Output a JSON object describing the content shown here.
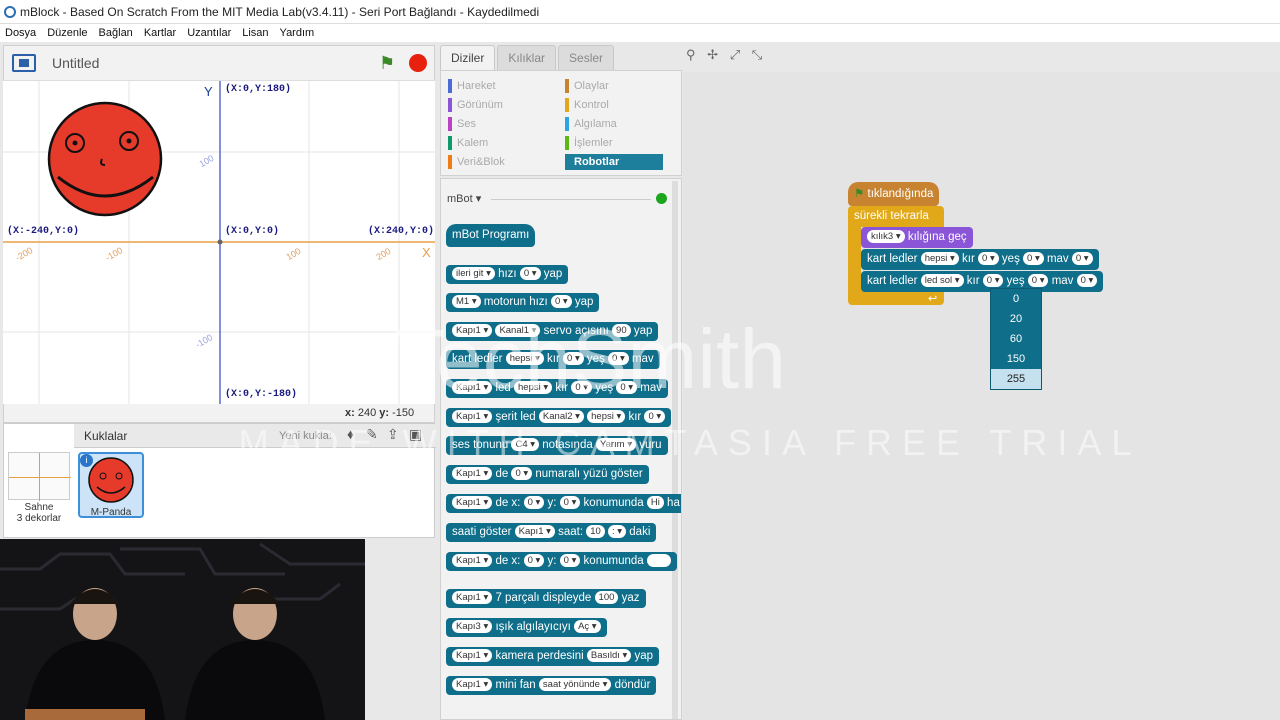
{
  "window": {
    "title": "mBlock - Based On Scratch From the MIT Media Lab(v3.4.11) - Seri Port Bağlandı - Kaydedilmedi"
  },
  "menu": [
    "Dosya",
    "Düzenle",
    "Bağlan",
    "Kartlar",
    "Uzantılar",
    "Lisan",
    "Yardım"
  ],
  "stage": {
    "title": "Untitled",
    "coords": {
      "top": "(X:0,Y:180)",
      "left": "(X:-240,Y:0)",
      "center": "(X:0,Y:0)",
      "right": "(X:240,Y:0)",
      "bottom": "(X:0,Y:-180)"
    },
    "x_axis_label": "X",
    "y_axis_label": "Y",
    "ticks": {
      "x_neg200": "-200",
      "x_neg100": "-100",
      "x_100": "100",
      "x_200": "200",
      "y_100": "100",
      "y_neg100": "-100"
    },
    "mouse_x_label": "x:",
    "mouse_x": "240",
    "mouse_y_label": "y:",
    "mouse_y": "-150"
  },
  "sprites": {
    "header": "Kuklalar",
    "new_sprite": "Yeni kukla:",
    "backdrop_label": "Sahne",
    "backdrop_count": "3 dekorlar",
    "sprite_name": "M-Panda"
  },
  "palette_tabs": [
    "Diziler",
    "Kılıklar",
    "Sesler"
  ],
  "categories": [
    {
      "label": "Hareket",
      "color": "#4a6cd4"
    },
    {
      "label": "Olaylar",
      "color": "#c88330"
    },
    {
      "label": "Görünüm",
      "color": "#8a55d7"
    },
    {
      "label": "Kontrol",
      "color": "#e1a91a"
    },
    {
      "label": "Ses",
      "color": "#bb42c3"
    },
    {
      "label": "Algılama",
      "color": "#2ca5e2"
    },
    {
      "label": "Kalem",
      "color": "#0e9a6c"
    },
    {
      "label": "İşlemler",
      "color": "#5cb712"
    },
    {
      "label": "Veri&Blok",
      "color": "#ee7d16"
    },
    {
      "label": "Robotlar",
      "color": "#1e7f9c"
    }
  ],
  "palette": {
    "group": "mBot",
    "program_block": "mBot Programı",
    "blocks": [
      [
        "ileri git",
        "hızı",
        "0",
        "yap"
      ],
      [
        "M1",
        "motorun hızı",
        "0",
        "yap"
      ],
      [
        "Kapı1",
        "Kanal1",
        "servo açısını",
        "90",
        "yap"
      ],
      [
        "kart ledler",
        "hepsi",
        "kır",
        "0",
        "yeş",
        "0",
        "mav"
      ],
      [
        "Kapı1",
        "led",
        "hepsi",
        "kır",
        "0",
        "yeş",
        "0",
        "mav"
      ],
      [
        "Kapı1",
        "şerit led",
        "Kanal2",
        "hepsi",
        "kır",
        "0"
      ],
      [
        "ses tonunu",
        "C4",
        "notasında",
        "Yarım",
        "vuru"
      ],
      [
        "Kapı1",
        "de",
        "0",
        "numaralı yüzü göster"
      ],
      [
        "Kapı1",
        "de x:",
        "0",
        "y:",
        "0",
        "konumunda",
        "Hi",
        "ha"
      ],
      [
        "saati göster",
        "Kapı1",
        "saat:",
        "10",
        ":",
        "daki"
      ],
      [
        "Kapı1",
        "de x:",
        "0",
        "y:",
        "0",
        "konumunda",
        ""
      ],
      [
        "Kapı1",
        "7 parçalı displeyde",
        "100",
        "yaz"
      ],
      [
        "Kapı3",
        "ışık algılayıcıyı",
        "Aç"
      ],
      [
        "Kapı1",
        "kamera perdesini",
        "Basıldı",
        "yap"
      ],
      [
        "Kapı1",
        "mini fan",
        "saat yönünde",
        "döndür"
      ]
    ]
  },
  "script": {
    "hat": "tıklandığında",
    "forever": "sürekli tekrarla",
    "costume": [
      "kılık3",
      "kılığına geç"
    ],
    "led1": [
      "kart ledler",
      "hepsi",
      "kır",
      "0",
      "yeş",
      "0",
      "mav",
      "0"
    ],
    "led2": [
      "kart ledler",
      "led sol",
      "kır",
      "0",
      "yeş",
      "0",
      "mav",
      "0"
    ],
    "dropdown": [
      "0",
      "20",
      "60",
      "150",
      "255"
    ],
    "dropdown_selected": "255"
  },
  "watermark": {
    "brand": "TechSmith",
    "line": "MADE WITH CAMTASIA FREE TRIAL"
  },
  "colors": {
    "motion": "#0f6e8a",
    "looks": "#8a55d7",
    "control": "#e1a91a",
    "events": "#c88330"
  }
}
